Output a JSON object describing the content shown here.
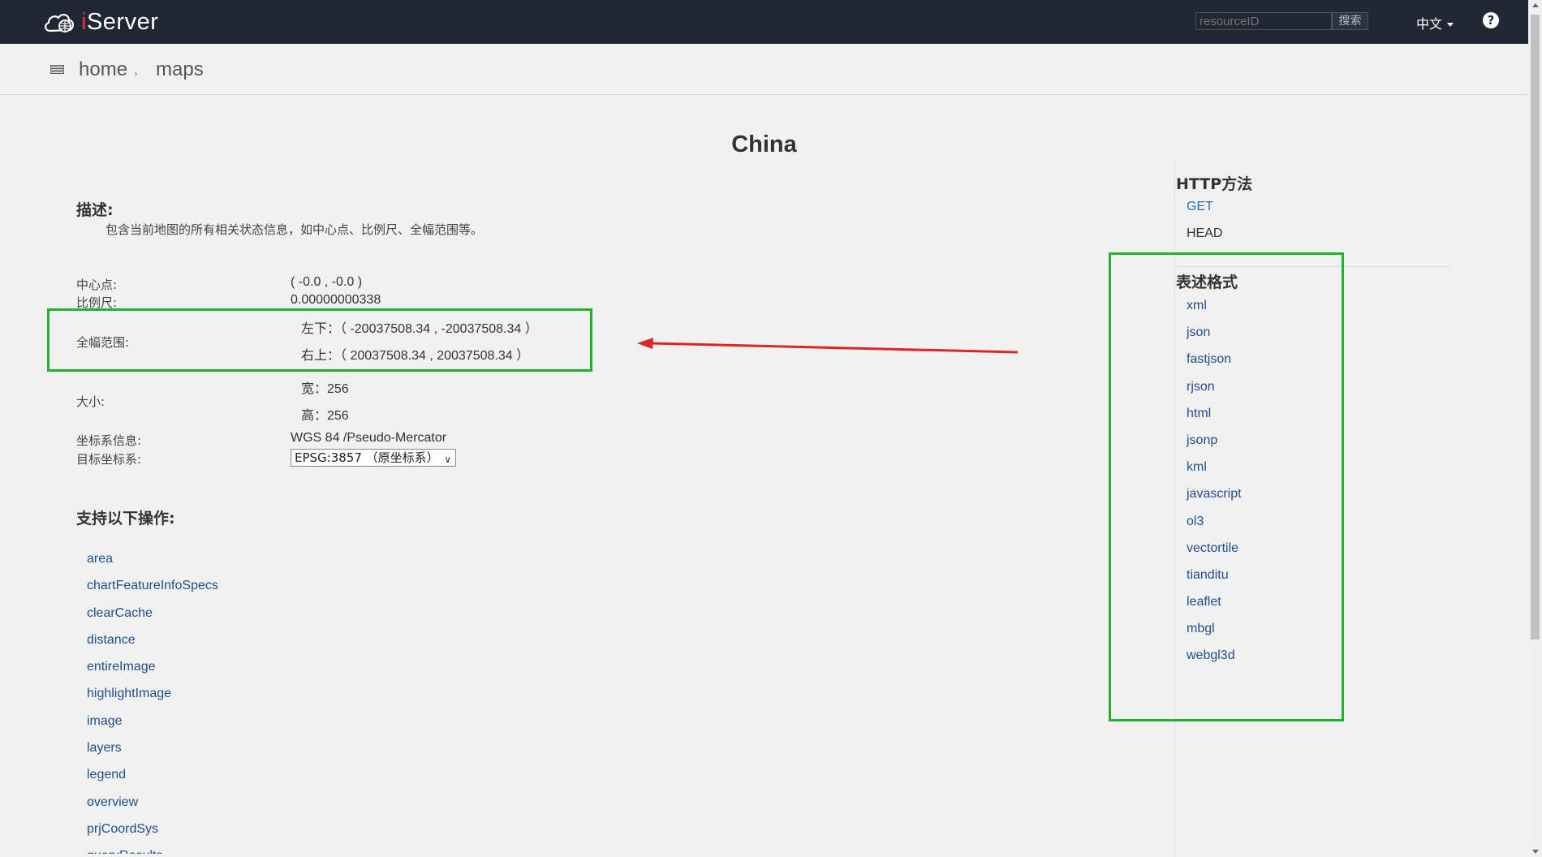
{
  "header": {
    "logo_prefix": "i",
    "logo_suffix": "Server",
    "search_placeholder": "resourceID",
    "search_button": "搜索",
    "language": "中文",
    "help": "?"
  },
  "breadcrumb": {
    "home": "home",
    "current": "maps",
    "sep": "›"
  },
  "page": {
    "title": "China",
    "desc_heading": "描述:",
    "desc_text": "包含当前地图的所有相关状态信息，如中心点、比例尺、全幅范围等。",
    "center_label": "中心点:",
    "center_value": "( -0.0 , -0.0 )",
    "scale_label": "比例尺:",
    "scale_value": "0.00000000338",
    "bounds_label": "全幅范围:",
    "bounds_lower_left": "左下：（ -20037508.34 , -20037508.34 ）",
    "bounds_upper_right": "右上：（ 20037508.34 , 20037508.34 ）",
    "size_label": "大小:",
    "width_value": "宽：256",
    "height_value": "高：256",
    "crs_label": "坐标系信息:",
    "crs_value": "WGS 84 /Pseudo-Mercator",
    "target_crs_label": "目标坐标系:",
    "target_crs_selected": "EPSG:3857 （原坐标系）",
    "ops_heading": "支持以下操作:",
    "operations": [
      "area",
      "chartFeatureInfoSpecs",
      "clearCache",
      "distance",
      "entireImage",
      "highlightImage",
      "image",
      "layers",
      "legend",
      "overview",
      "prjCoordSys",
      "queryResults"
    ]
  },
  "sidebar": {
    "http_heading": "HTTP方法",
    "methods": [
      "GET",
      "HEAD"
    ],
    "formats_heading": "表述格式",
    "formats": [
      "xml",
      "json",
      "fastjson",
      "rjson",
      "html",
      "jsonp",
      "kml",
      "javascript",
      "ol3",
      "vectortile",
      "tianditu",
      "leaflet",
      "mbgl",
      "webgl3d"
    ]
  },
  "colors": {
    "topbar": "#1f2733",
    "link": "#1d4e89",
    "highlight_box": "#22b02f",
    "arrow": "#e02424"
  }
}
